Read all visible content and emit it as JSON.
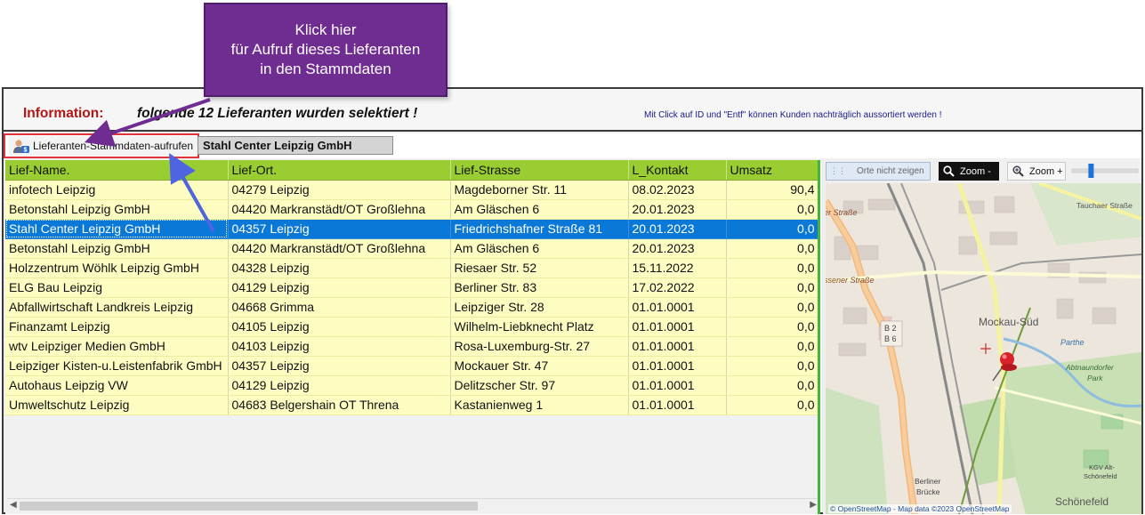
{
  "callout": {
    "line1": "Klick hier",
    "line2": "für Aufruf dieses Lieferanten",
    "line3": "in den Stammdaten"
  },
  "info": {
    "label": "Information:",
    "message": "folgende 12  Lieferanten wurden selektiert !",
    "hint": "Mit Click auf ID und \"Entf\" können Kunden nachträglich aussortiert werden !"
  },
  "toolbar": {
    "open_button_label": "Lieferanten-Stammdaten-aufrufen",
    "open_button_icon": "user-card-icon",
    "selected_supplier": "Stahl Center Leipzig GmbH"
  },
  "grid": {
    "columns": [
      "Lief-Name.",
      "Lief-Ort.",
      "Lief-Strasse",
      "L_Kontakt",
      "Umsatz"
    ],
    "rows": [
      {
        "name": "infotech Leipzig",
        "ort": "04279 Leipzig",
        "strasse": "Magdeborner Str. 11",
        "kontakt": "08.02.2023",
        "umsatz": "90,4"
      },
      {
        "name": "Betonstahl Leipzig GmbH",
        "ort": "04420 Markranstädt/OT Großlehna",
        "strasse": "Am Gläschen 6",
        "kontakt": "20.01.2023",
        "umsatz": "0,0"
      },
      {
        "name": "Stahl Center Leipzig GmbH",
        "ort": "04357 Leipzig",
        "strasse": "Friedrichshafner Straße 81",
        "kontakt": "20.01.2023",
        "umsatz": "0,0"
      },
      {
        "name": "Betonstahl Leipzig GmbH",
        "ort": "04420 Markranstädt/OT Großlehna",
        "strasse": "Am Gläschen 6",
        "kontakt": "20.01.2023",
        "umsatz": "0,0"
      },
      {
        "name": "Holzzentrum Wöhlk Leipzig GmbH",
        "ort": "04328 Leipzig",
        "strasse": "Riesaer Str. 52",
        "kontakt": "15.11.2022",
        "umsatz": "0,0"
      },
      {
        "name": "ELG Bau Leipzig",
        "ort": "04129 Leipzig",
        "strasse": "Berliner Str. 83",
        "kontakt": "17.02.2022",
        "umsatz": "0,0"
      },
      {
        "name": "Abfallwirtschaft Landkreis Leipzig",
        "ort": "04668 Grimma",
        "strasse": "Leipziger Str. 28",
        "kontakt": "01.01.0001",
        "umsatz": "0,0"
      },
      {
        "name": "Finanzamt Leipzig",
        "ort": "04105 Leipzig",
        "strasse": "Wilhelm-Liebknecht  Platz",
        "kontakt": "01.01.0001",
        "umsatz": "0,0"
      },
      {
        "name": "wtv Leipziger Medien GmbH",
        "ort": "04103 Leipzig",
        "strasse": "Rosa-Luxemburg-Str. 27",
        "kontakt": "01.01.0001",
        "umsatz": "0,0"
      },
      {
        "name": "Leipziger  Kisten-u.Leistenfabrik  GmbH",
        "ort": "04357 Leipzig",
        "strasse": "Mockauer Str. 47",
        "kontakt": "01.01.0001",
        "umsatz": "0,0"
      },
      {
        "name": "Autohaus Leipzig VW",
        "ort": "04129 Leipzig",
        "strasse": "Delitzscher Str. 97",
        "kontakt": "01.01.0001",
        "umsatz": "0,0"
      },
      {
        "name": "Umweltschutz Leipzig",
        "ort": "04683 Belgershain OT Threna",
        "strasse": "Kastanienweg 1",
        "kontakt": "01.01.0001",
        "umsatz": "0,0"
      }
    ],
    "selected_row": 2
  },
  "map": {
    "hide_places_label": "Orte nicht zeigen",
    "zoom_out_label": "Zoom -",
    "zoom_in_label": "Zoom +",
    "zoom_level": 0.27,
    "labels": {
      "mockau": "Mockau-Süd",
      "abtnaundorfer": "Abtnaundorfer",
      "park": "Park",
      "schoenefeld": "Schönefeld",
      "berliner": "Berliner",
      "bruecke": "Brücke",
      "kgv": "KGV Alt-",
      "kgv2": "Schönefeld",
      "tauchaer": "Tauchaer Straße",
      "strasse1": "er Straße",
      "strasse2": "ssener Straße",
      "parthe": "Parthe",
      "b2": "B 2",
      "b6": "B 6"
    },
    "credit": "© OpenStreetMap - Map data ©2023 OpenStreetMap"
  }
}
